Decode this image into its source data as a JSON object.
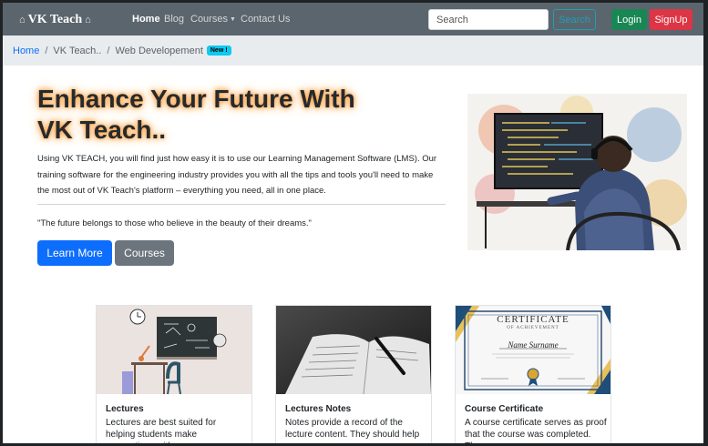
{
  "navbar": {
    "brand": "VK Teach",
    "links": [
      "Home",
      "Blog",
      "Courses",
      "Contact Us"
    ],
    "search_placeholder": "Search",
    "search_button": "Search",
    "login_button": "Login",
    "signup_button": "SignUp"
  },
  "breadcrumb": {
    "items": [
      "Home",
      "VK Teach..",
      "Web Developement"
    ],
    "badge": "New !"
  },
  "hero": {
    "title_line1": "Enhance Your Future With",
    "title_line2": "VK Teach..",
    "body": "Using VK TEACH, you will find just how easy it is to use our Learning Management Software (LMS). Our training software for the engineering industry provides you with all the tips and tools you'll need to make the most out of VK Teach's platform – everything you need, all in one place.",
    "quote": "\"The future belongs to those who believe in the beauty of their dreams.\"",
    "learn_more_button": "Learn More",
    "courses_button": "Courses"
  },
  "cards": [
    {
      "title": "Lectures",
      "text": "Lectures are best suited for helping students make connections with"
    },
    {
      "title": "Lectures Notes",
      "text": "Notes provide a record of the lecture content. They should help"
    },
    {
      "title": "Course Certificate",
      "text": "A course certificate serves as proof that the course was completed. The"
    }
  ],
  "certificate": {
    "heading": "CERTIFICATE",
    "subheading": "OF ACHIEVEMENT",
    "name": "Name Surname"
  },
  "colors": {
    "navbar": "#5b656d",
    "primary": "#0d6efd",
    "success": "#198754",
    "danger": "#dc3545",
    "info": "#17a2b8",
    "secondary": "#6c757d"
  }
}
